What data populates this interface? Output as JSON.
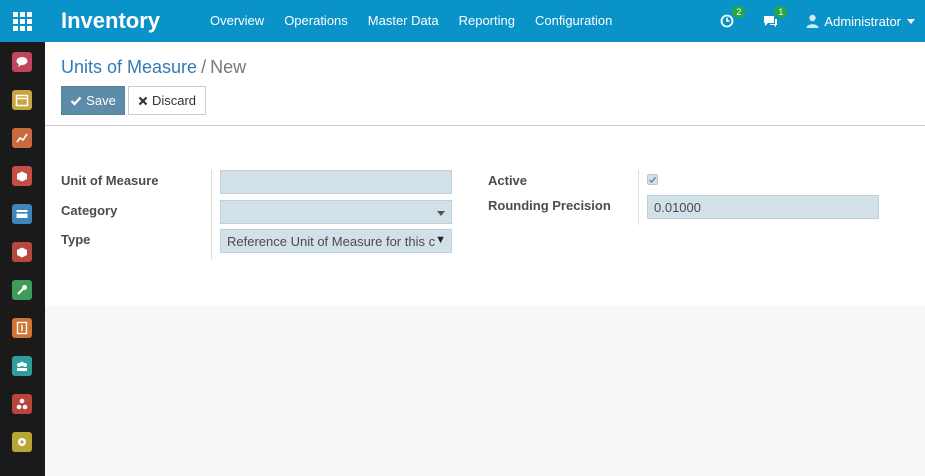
{
  "app": {
    "title": "Inventory",
    "menu": [
      "Overview",
      "Operations",
      "Master Data",
      "Reporting",
      "Configuration"
    ],
    "activity_count": "2",
    "message_count": "1",
    "user_name": "Administrator"
  },
  "sidebar": {
    "apps": [
      {
        "name": "discuss-app",
        "color": "#c0455d"
      },
      {
        "name": "calendar-app",
        "color": "#c9a442"
      },
      {
        "name": "dashboard-app",
        "color": "#c96b3e"
      },
      {
        "name": "sales-app",
        "color": "#c24e45"
      },
      {
        "name": "invoicing-app",
        "color": "#3d86b7"
      },
      {
        "name": "inventory-app",
        "color": "#b5483f"
      },
      {
        "name": "tools-app",
        "color": "#3e9c5a"
      },
      {
        "name": "expenses-app",
        "color": "#d07533"
      },
      {
        "name": "employees-app",
        "color": "#2f9d9b"
      },
      {
        "name": "manufacturing-app",
        "color": "#b8453e"
      },
      {
        "name": "settings-app",
        "color": "#b8a634"
      }
    ]
  },
  "breadcrumb": {
    "parent": "Units of Measure",
    "separator": "/",
    "current": "New"
  },
  "actions": {
    "save_label": "Save",
    "discard_label": "Discard"
  },
  "form": {
    "uom_label": "Unit of Measure",
    "uom_value": "",
    "category_label": "Category",
    "category_value": "",
    "type_label": "Type",
    "type_value": "Reference Unit of Measure for this c",
    "active_label": "Active",
    "active_checked": true,
    "rounding_label": "Rounding Precision",
    "rounding_value": "0.01000"
  }
}
